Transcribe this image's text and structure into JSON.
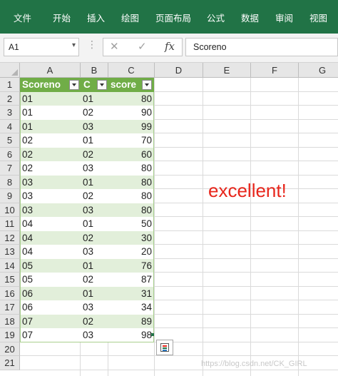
{
  "ribbon": {
    "tabs": [
      "文件",
      "开始",
      "插入",
      "绘图",
      "页面布局",
      "公式",
      "数据",
      "审阅",
      "视图"
    ],
    "background": "#217346"
  },
  "formula_bar": {
    "name_box": "A1",
    "formula": "Scoreno",
    "cancel_icon": "cancel-x-icon",
    "enter_icon": "enter-check-icon",
    "fx_label": "fx"
  },
  "columns": [
    "A",
    "B",
    "C",
    "D",
    "E",
    "F",
    "G"
  ],
  "rows": [
    "1",
    "2",
    "3",
    "4",
    "5",
    "6",
    "7",
    "8",
    "9",
    "10",
    "11",
    "12",
    "13",
    "14",
    "15",
    "16",
    "17",
    "18",
    "19",
    "20",
    "21"
  ],
  "table": {
    "headers": [
      "Scoreno",
      "C",
      "score"
    ],
    "header_color": "#70ad47",
    "band_color": "#e2efda",
    "rows": [
      [
        "01",
        "01",
        "80"
      ],
      [
        "01",
        "02",
        "90"
      ],
      [
        "01",
        "03",
        "99"
      ],
      [
        "02",
        "01",
        "70"
      ],
      [
        "02",
        "02",
        "60"
      ],
      [
        "02",
        "03",
        "80"
      ],
      [
        "03",
        "01",
        "80"
      ],
      [
        "03",
        "02",
        "80"
      ],
      [
        "03",
        "03",
        "80"
      ],
      [
        "04",
        "01",
        "50"
      ],
      [
        "04",
        "02",
        "30"
      ],
      [
        "04",
        "03",
        "20"
      ],
      [
        "05",
        "01",
        "76"
      ],
      [
        "05",
        "02",
        "87"
      ],
      [
        "06",
        "01",
        "31"
      ],
      [
        "06",
        "03",
        "34"
      ],
      [
        "07",
        "02",
        "89"
      ],
      [
        "07",
        "03",
        "98"
      ]
    ]
  },
  "note": {
    "text": "excellent!",
    "color": "#e8261c"
  },
  "watermark": "https://blog.csdn.net/CK_GIRL"
}
